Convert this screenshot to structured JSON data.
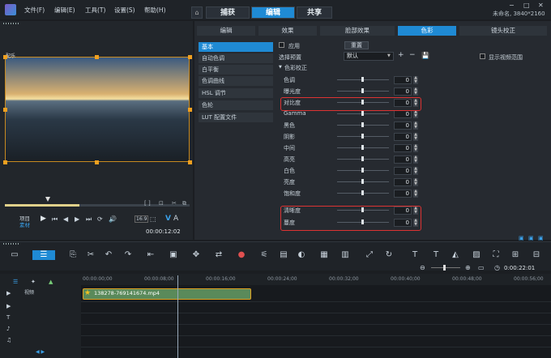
{
  "menu": {
    "file": "文件(F)",
    "edit": "编辑(E)",
    "tools": "工具(T)",
    "settings": "设置(S)",
    "help": "帮助(H)"
  },
  "main_tabs": [
    "捕获",
    "编辑",
    "共享"
  ],
  "project_info": "未命名, 3840*2160",
  "sub_tabs": [
    "编辑",
    "效果",
    "脸部效果",
    "色彩",
    "镜头校正"
  ],
  "categories": [
    "基本",
    "自动色调",
    "白平衡",
    "色调曲线",
    "HSL 调节",
    "色轮",
    "LUT 配置文件"
  ],
  "apply_label": "应用",
  "reset_button": "重置",
  "preset_label": "选择预置",
  "preset_value": "默认",
  "show_range": "显示视频范围",
  "section": "色彩校正",
  "params": [
    {
      "label": "色调",
      "value": "0"
    },
    {
      "label": "曝光度",
      "value": "0"
    },
    {
      "label": "对比度",
      "value": "0"
    },
    {
      "label": "Gamma",
      "value": "0"
    },
    {
      "label": "黑色",
      "value": "0"
    },
    {
      "label": "阴影",
      "value": "0"
    },
    {
      "label": "中间",
      "value": "0"
    },
    {
      "label": "高亮",
      "value": "0"
    },
    {
      "label": "白色",
      "value": "0"
    },
    {
      "label": "亮度",
      "value": "0"
    },
    {
      "label": "饱和度",
      "value": "0"
    },
    {
      "label": "清晰度",
      "value": "0"
    },
    {
      "label": "蔓度",
      "value": "0"
    }
  ],
  "preview": {
    "project_label": "项目",
    "clip_label": "素材",
    "timecode": "00:00:12:02",
    "badge": "配乐"
  },
  "timeline": {
    "ticks": [
      "00:00:00;00",
      "00:00:08;00",
      "00:00:16;00",
      "00:00:24;00",
      "00:00:32;00",
      "00:00:40;00",
      "00:00:48;00",
      "00:00:56;00"
    ],
    "clip_name": "138278-769141674.mp4",
    "duration": "0:00:22:01",
    "track_label": "视频"
  }
}
